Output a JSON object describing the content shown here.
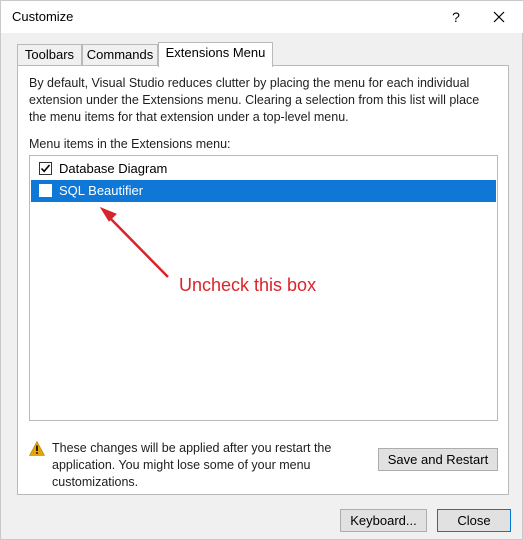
{
  "window": {
    "title": "Customize",
    "help_label": "?"
  },
  "tabs": [
    {
      "label": "Toolbars"
    },
    {
      "label": "Commands"
    },
    {
      "label": "Extensions Menu"
    }
  ],
  "panel": {
    "description": "By default, Visual Studio reduces clutter by placing the menu for each individual extension under the Extensions menu. Clearing a selection from this list will place the menu items for that extension under a top-level menu.",
    "list_label": "Menu items in the Extensions menu:",
    "items": [
      {
        "label": "Database Diagram",
        "checked": true,
        "selected": false
      },
      {
        "label": "SQL Beautifier",
        "checked": false,
        "selected": true
      }
    ],
    "annotation": "Uncheck this box",
    "annotation_color": "#d9242b",
    "selection_color": "#0f78d7"
  },
  "warning": {
    "icon": "warning-icon",
    "text": "These changes will be applied after you restart the application. You might lose some of your menu customizations."
  },
  "buttons": {
    "save_restart": "Save and Restart",
    "keyboard": "Keyboard...",
    "close": "Close"
  }
}
